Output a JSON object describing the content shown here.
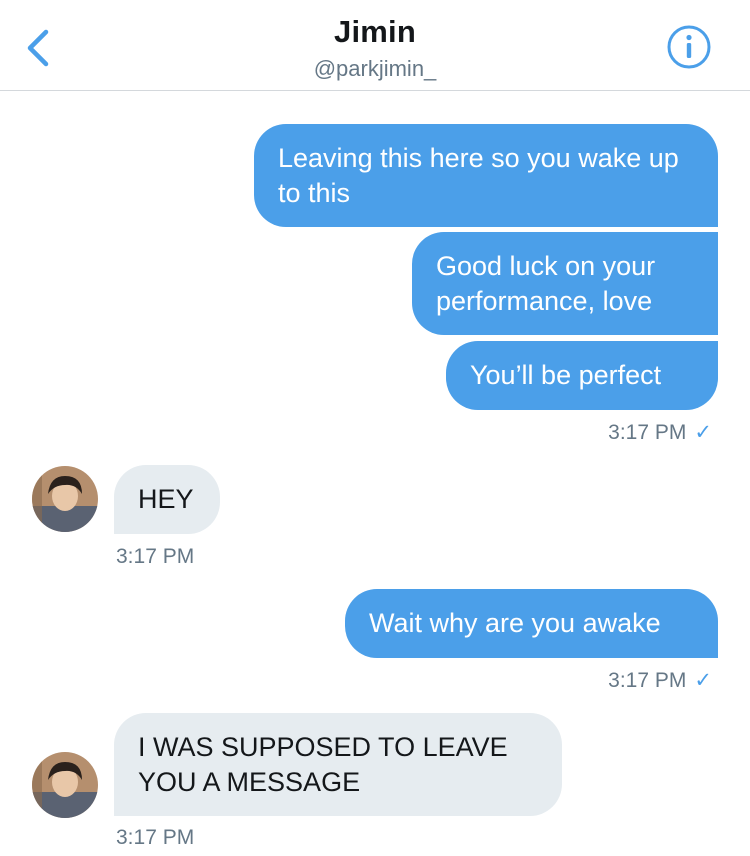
{
  "header": {
    "name": "Jimin",
    "handle": "@parkjimin_",
    "back_icon": "chevron-left-icon",
    "info_icon": "info-icon"
  },
  "colors": {
    "accent": "#4b9fe9",
    "incoming_bubble": "#e6ecf0",
    "timestamp": "#657786"
  },
  "messages": {
    "m1": "Leaving this here so you wake up to this",
    "m2": "Good luck on your performance, love",
    "m3": "You’ll be perfect",
    "t1": "3:17 PM",
    "m4": "HEY",
    "t2": "3:17 PM",
    "m5": "Wait why are you awake",
    "t3": "3:17 PM",
    "m6": "I WAS SUPPOSED TO LEAVE YOU A MESSAGE",
    "t4": "3:17 PM",
    "read_check": "✓"
  }
}
